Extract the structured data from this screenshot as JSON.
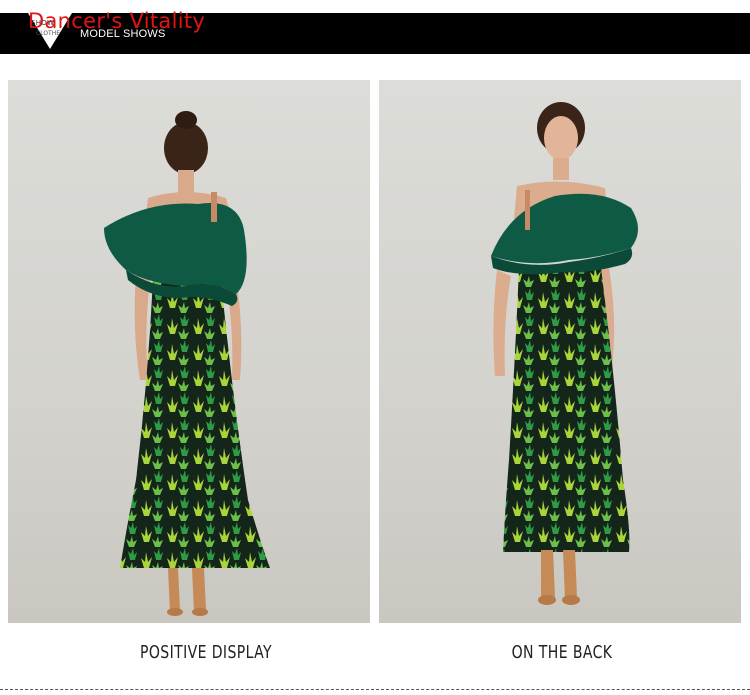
{
  "header": {
    "brand": "Dancer's Vitality",
    "badge_top": "SHOW",
    "badge_bottom": "CLOTHE",
    "section_title": "MODEL SHOWS"
  },
  "photos": [
    {
      "caption": "POSITIVE DISPLAY"
    },
    {
      "caption": "ON THE BACK"
    }
  ],
  "colors": {
    "header_bg": "#000000",
    "brand": "#e01414",
    "top_fabric": "#0f5a45",
    "leaf_light": "#a9d43a",
    "leaf_dark": "#1f7a3a"
  }
}
